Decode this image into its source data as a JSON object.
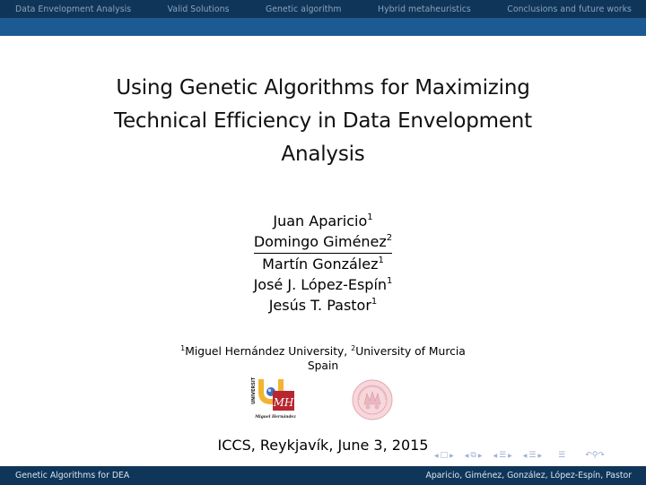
{
  "header": {
    "sections": [
      {
        "label": "Data Envelopment Analysis"
      },
      {
        "label": "Valid Solutions"
      },
      {
        "label": "Genetic algorithm"
      },
      {
        "label": "Hybrid metaheuristics"
      },
      {
        "label": "Conclusions and future works"
      }
    ]
  },
  "slide": {
    "title_lines": [
      "Using Genetic Algorithms for Maximizing",
      "Technical Efficiency in Data Envelopment",
      "Analysis"
    ],
    "authors": [
      {
        "name": "Juan Aparicio",
        "affiliation": "1"
      },
      {
        "name": "Domingo Giménez",
        "affiliation": "2"
      },
      {
        "name": "Martín González",
        "affiliation": "1"
      },
      {
        "name": "José J. López-Espín",
        "affiliation": "1"
      },
      {
        "name": "Jesús T. Pastor",
        "affiliation": "1"
      }
    ],
    "affiliations": {
      "first_mark": "1",
      "first_name": "Miguel Hernández University, ",
      "second_mark": "2",
      "second_name": "University of Murcia",
      "country": "Spain"
    },
    "logos": {
      "umh": {
        "vertical_text": "UNIVERSITAS",
        "monogram": "MH",
        "caption": "Miguel Hernández"
      },
      "um": {
        "name": "University of Murcia seal"
      }
    },
    "event": "ICCS, Reykjavík, June 3, 2015"
  },
  "nav_controls": {
    "icons": [
      "frame-nav",
      "slide-nav",
      "subsection-nav",
      "section-nav",
      "document-nav",
      "search-back-forward"
    ]
  },
  "footer": {
    "short_title": "Genetic Algorithms for DEA",
    "short_authors": "Aparicio, Giménez, González, López-Espín, Pastor"
  },
  "colors": {
    "header_dark": "#0f3659",
    "header_light": "#1c5a92",
    "nav_text": "#8aa3bd",
    "footer_text": "#dbe4ef"
  }
}
